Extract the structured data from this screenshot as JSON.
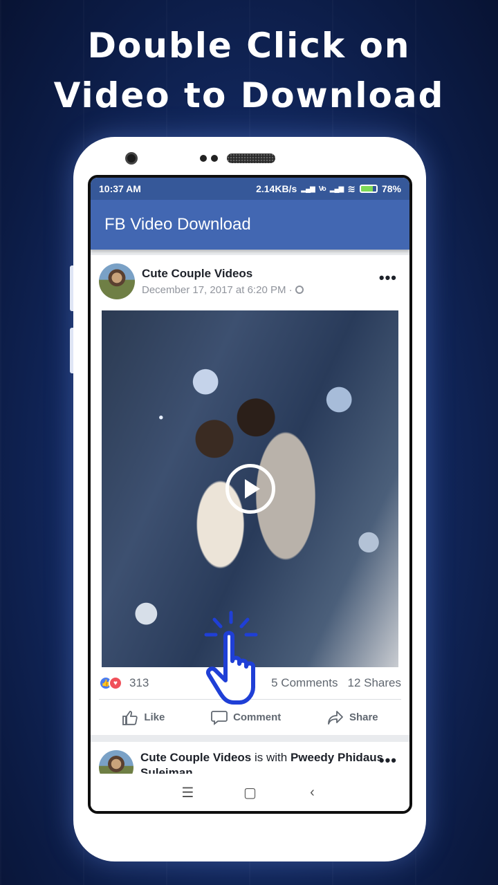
{
  "headline": {
    "line1": "Double Click on",
    "line2": "Video to Download"
  },
  "status_bar": {
    "time": "10:37 AM",
    "speed": "2.14KB/s",
    "battery": "78%"
  },
  "app_bar": {
    "title": "FB Video Download"
  },
  "post": {
    "author": "Cute Couple Videos",
    "date": "December 17, 2017 at 6:20 PM · ",
    "reaction_count": "313",
    "comments": "5 Comments",
    "shares": "12 Shares",
    "actions": {
      "like": "Like",
      "comment": "Comment",
      "share": "Share"
    }
  },
  "post2": {
    "author": "Cute Couple Videos",
    "with_text": " is with ",
    "tagged": "Pweedy Phidaus Suleiman",
    "end": "."
  },
  "nav": {
    "recents": "☰",
    "home": "▢",
    "back": "‹"
  },
  "colors": {
    "app_bar": "#4267b2",
    "status_bar": "#365899",
    "background": "#142c66",
    "hand": "#1f3fd6"
  }
}
